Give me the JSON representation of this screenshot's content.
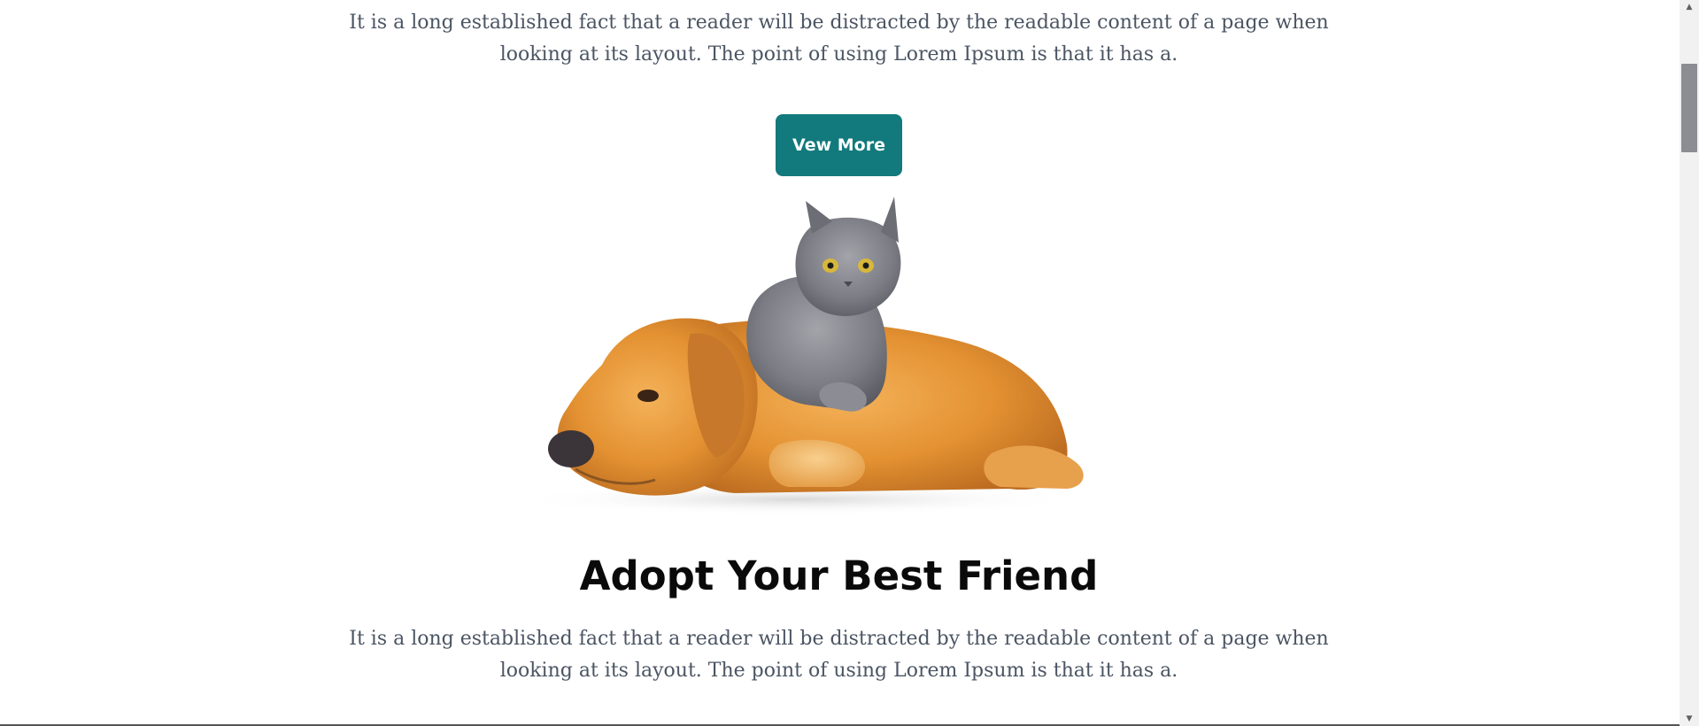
{
  "sections": {
    "intro": {
      "paragraph": "It is a long established fact that a reader will be distracted by the readable content of a page when looking at its layout. The point of using Lorem Ipsum is that it has a.",
      "button_label": "Vew More"
    },
    "adopt": {
      "heading": "Adopt Your Best Friend",
      "paragraph": "It is a long established fact that a reader will be distracted by the readable content of a page when looking at its layout. The point of using Lorem Ipsum is that it has a."
    }
  },
  "colors": {
    "button": "#127a7c",
    "body_text": "#4b5563",
    "heading": "#0a0a0a"
  },
  "icons": {
    "scroll_up": "scroll-up-arrow-icon",
    "scroll_down": "scroll-down-arrow-icon"
  }
}
